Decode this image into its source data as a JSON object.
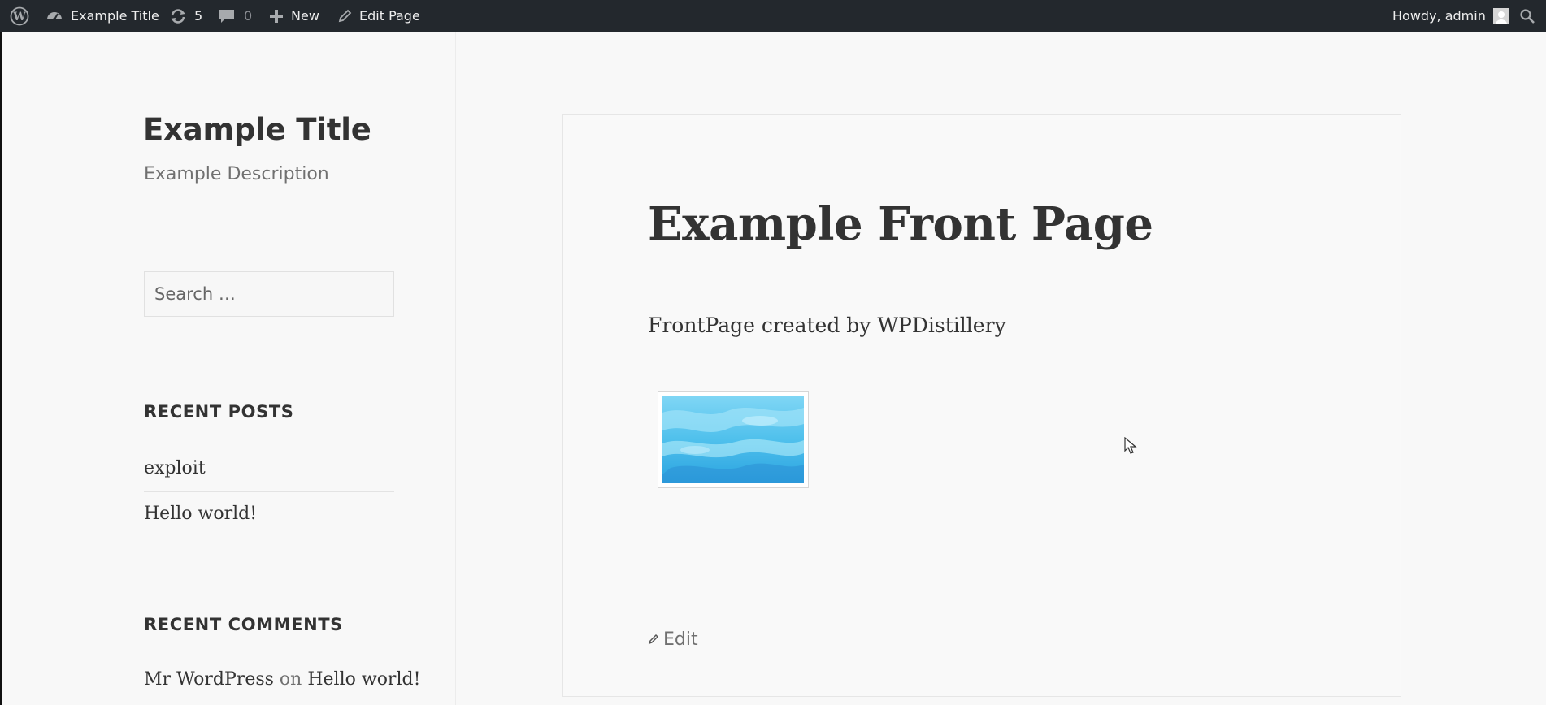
{
  "admin_bar": {
    "site_name": "Example Title",
    "updates_count": "5",
    "comments_count": "0",
    "new_label": "New",
    "edit_page_label": "Edit Page",
    "greeting": "Howdy, admin"
  },
  "sidebar": {
    "site_title": "Example Title",
    "site_description": "Example Description",
    "search_placeholder": "Search …",
    "recent_posts": {
      "heading": "RECENT POSTS",
      "items": [
        "exploit",
        "Hello world!"
      ]
    },
    "recent_comments": {
      "heading": "RECENT COMMENTS",
      "author": "Mr WordPress",
      "on": "on",
      "post": "Hello world!"
    }
  },
  "main": {
    "title": "Example Front Page",
    "content": "FrontPage created by WPDistillery",
    "edit_label": "Edit"
  },
  "colors": {
    "admin_bar_bg": "#23282d",
    "page_bg": "#f8f8f8",
    "text": "#333333",
    "muted_text": "#707070"
  }
}
